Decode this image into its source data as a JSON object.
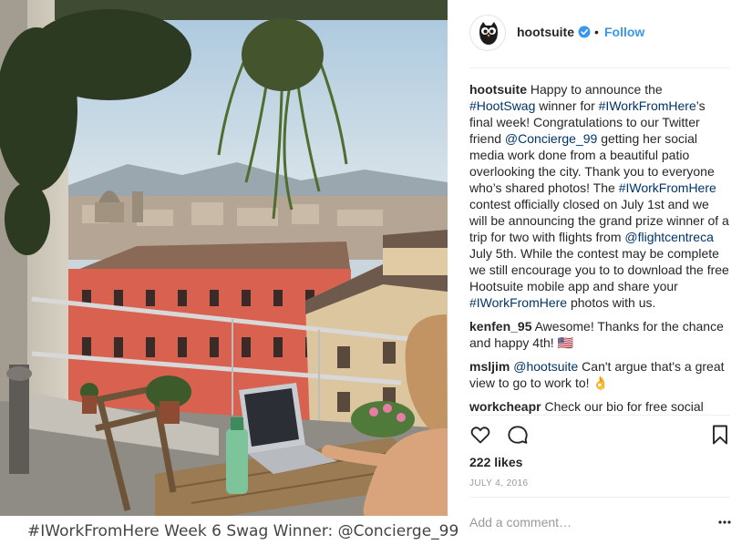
{
  "photo": {
    "caption": "#IWorkFromHere Week 6 Swag Winner: @Concierge_99"
  },
  "header": {
    "username": "hootsuite",
    "separator": "•",
    "follow_label": "Follow",
    "avatar_icon": "hootsuite-owl-logo",
    "verified_icon": "verified-badge-icon"
  },
  "comments": [
    {
      "username": "hootsuite",
      "parts": [
        {
          "t": " Happy to announce the "
        },
        {
          "t": "#HootSwag",
          "tag": true
        },
        {
          "t": " winner for "
        },
        {
          "t": "#IWorkFromHere",
          "tag": true
        },
        {
          "t": "’s final week! Congratulations to our Twitter friend "
        },
        {
          "t": "@Concierge_99",
          "tag": true
        },
        {
          "t": " getting her social media work done from a beautiful patio overlooking the city. Thank you to everyone who’s shared photos! The "
        },
        {
          "t": "#IWorkFromHere",
          "tag": true
        },
        {
          "t": " contest officially closed on July 1st and we will be announcing the grand prize winner of a trip for two with flights from "
        },
        {
          "t": "@flightcentreca",
          "tag": true
        },
        {
          "t": " July 5th. While the contest may be complete we still encourage you to to download the free Hootsuite mobile app and share your "
        },
        {
          "t": "#IWorkFromHere",
          "tag": true
        },
        {
          "t": " photos with us."
        }
      ]
    },
    {
      "username": "kenfen_95",
      "parts": [
        {
          "t": " Awesome! Thanks for the chance and happy 4th! 🇺🇸"
        }
      ]
    },
    {
      "username": "msljim",
      "parts": [
        {
          "t": " "
        },
        {
          "t": "@hootsuite",
          "tag": true
        },
        {
          "t": " Can't argue that's a great view to go to work to! 👌"
        }
      ]
    },
    {
      "username": "workcheapr",
      "parts": [
        {
          "t": " Check our bio for free social"
        }
      ]
    }
  ],
  "actions": {
    "like_icon": "heart-icon",
    "comment_icon": "comment-bubble-icon",
    "save_icon": "bookmark-icon"
  },
  "likes": "222 likes",
  "date": "JULY 4, 2016",
  "add_comment": {
    "placeholder": "Add a comment…",
    "more_icon": "ellipsis-icon"
  },
  "colors": {
    "link": "#3897f0",
    "hashtag": "#003569",
    "muted": "#999999",
    "verified": "#3897f0"
  }
}
